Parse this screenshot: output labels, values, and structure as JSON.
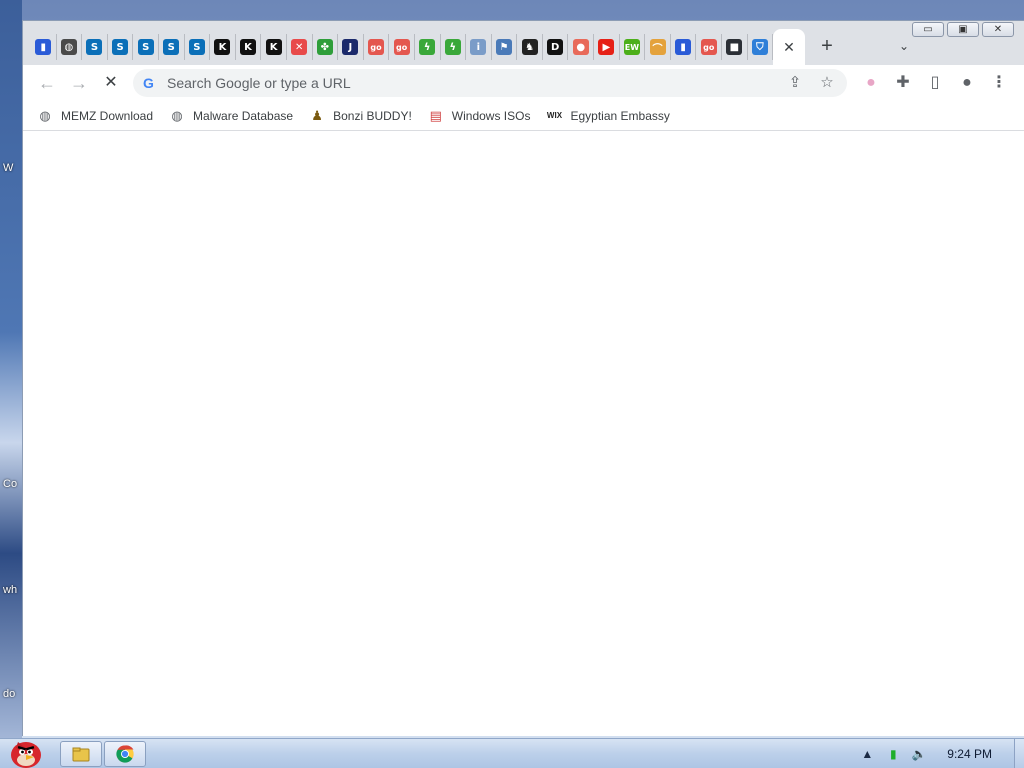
{
  "desktop": {
    "fragments": [
      "W",
      "Co",
      "wh",
      "do"
    ]
  },
  "browser": {
    "tabs": [
      {
        "icon": "shopping-bag-icon",
        "color": "#2a5bd7",
        "glyph": "▮"
      },
      {
        "icon": "globe-icon",
        "color": "#4a4a4a",
        "glyph": "◍"
      },
      {
        "icon": "s-logo-icon",
        "color": "#0b6fb8",
        "glyph": "S"
      },
      {
        "icon": "s-logo-icon",
        "color": "#0b6fb8",
        "glyph": "S"
      },
      {
        "icon": "s-logo-icon",
        "color": "#0b6fb8",
        "glyph": "S"
      },
      {
        "icon": "s-logo-icon",
        "color": "#0b6fb8",
        "glyph": "S"
      },
      {
        "icon": "s-logo-icon",
        "color": "#0b6fb8",
        "glyph": "S"
      },
      {
        "icon": "k-logo-icon",
        "color": "#111111",
        "glyph": "K"
      },
      {
        "icon": "k-logo-icon",
        "color": "#111111",
        "glyph": "K"
      },
      {
        "icon": "k-logo-icon",
        "color": "#111111",
        "glyph": "K"
      },
      {
        "icon": "red-x-icon",
        "color": "#e84a4a",
        "glyph": "✕"
      },
      {
        "icon": "clover-icon",
        "color": "#2e9e3a",
        "glyph": "✤"
      },
      {
        "icon": "j-logo-icon",
        "color": "#1b2a6b",
        "glyph": "J"
      },
      {
        "icon": "go-logo-icon",
        "color": "#e4574f",
        "glyph": "go"
      },
      {
        "icon": "go-logo-icon",
        "color": "#e4574f",
        "glyph": "go"
      },
      {
        "icon": "lightning-icon",
        "color": "#3aa83a",
        "glyph": "ϟ"
      },
      {
        "icon": "lightning-icon",
        "color": "#3aa83a",
        "glyph": "ϟ"
      },
      {
        "icon": "info-icon",
        "color": "#7a9cc8",
        "glyph": "i"
      },
      {
        "icon": "flag-icon",
        "color": "#4a7ab8",
        "glyph": "⚑"
      },
      {
        "icon": "horse-icon",
        "color": "#222222",
        "glyph": "♞"
      },
      {
        "icon": "d-logo-icon",
        "color": "#111111",
        "glyph": "D"
      },
      {
        "icon": "circle-logo-icon",
        "color": "#e86a5a",
        "glyph": "●"
      },
      {
        "icon": "youtube-icon",
        "color": "#e62117",
        "glyph": "▶"
      },
      {
        "icon": "ew-logo-icon",
        "color": "#4caf1a",
        "glyph": "EW"
      },
      {
        "icon": "rainbow-icon",
        "color": "#e4a23c",
        "glyph": "⌒"
      },
      {
        "icon": "shopping-bag-icon",
        "color": "#2a5bd7",
        "glyph": "▮"
      },
      {
        "icon": "go-logo-icon",
        "color": "#e4574f",
        "glyph": "go"
      },
      {
        "icon": "dark-square-icon",
        "color": "#2b2f36",
        "glyph": "■"
      },
      {
        "icon": "shield-icon",
        "color": "#2f7fd8",
        "glyph": "⛉"
      }
    ],
    "active_tab_close": "✕",
    "new_tab": "+",
    "tab_search": "⌄",
    "window_controls": {
      "minimize": "▭",
      "maximize": "▣",
      "close": "✕"
    },
    "toolbar": {
      "back": "←",
      "forward": "→",
      "stop": "✕",
      "omnibox_placeholder": "Search Google or type a URL",
      "omnibox_value": "",
      "share": "⇪",
      "star": "☆",
      "profile_chip": "●",
      "extensions": "✚",
      "sidepanel": "▯",
      "profile": "●",
      "menu": "⋮"
    },
    "bookmarks": [
      {
        "label": "MEMZ Download",
        "icon": "globe-icon",
        "glyph": "◍",
        "color": "#5f6368"
      },
      {
        "label": "Malware Database",
        "icon": "globe-icon",
        "glyph": "◍",
        "color": "#5f6368"
      },
      {
        "label": "Bonzi BUDDY!",
        "icon": "bonzi-icon",
        "glyph": "♟",
        "color": "#7a5a10"
      },
      {
        "label": "Windows ISOs",
        "icon": "rainbow-flag-icon",
        "glyph": "▤",
        "color": "#d04040"
      },
      {
        "label": "Egyptian Embassy",
        "icon": "wix-icon",
        "glyph": "WIX",
        "color": "#222222"
      }
    ]
  },
  "taskbar": {
    "clock": "9:24 PM",
    "tray": {
      "arrow": "▲",
      "battery": "▮",
      "volume": "🔈"
    }
  },
  "colors": {
    "tabstrip": "#dee1e6",
    "omnibox": "#f1f3f4",
    "taskbar": "#bcd0ea"
  }
}
